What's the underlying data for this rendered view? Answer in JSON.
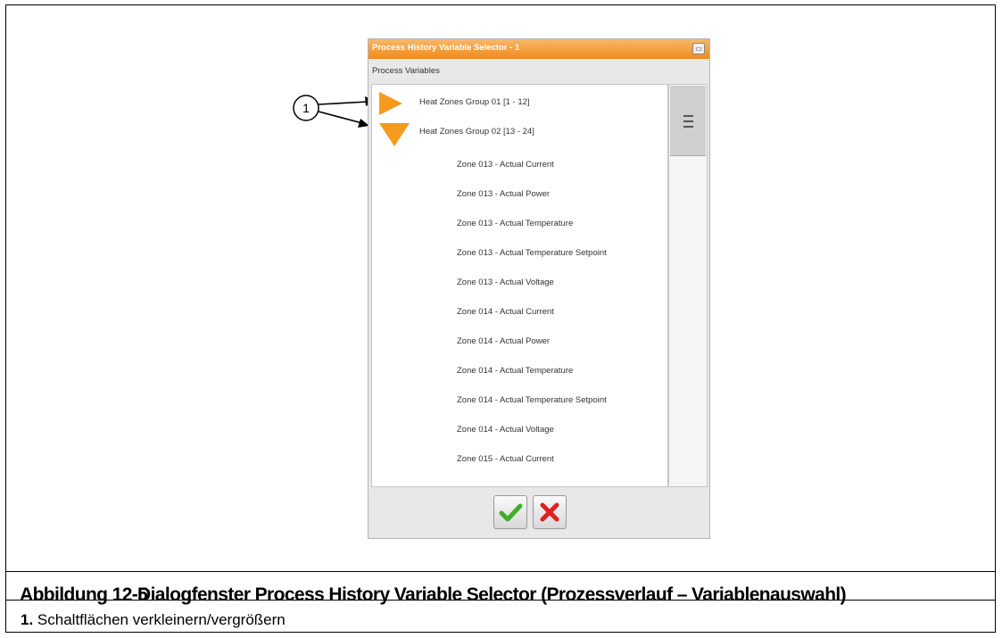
{
  "dialog": {
    "title": "Process History Variable Selector - 1",
    "section_label": "Process Variables",
    "groups": [
      {
        "label": "Heat Zones Group 01 [1 - 12]",
        "state": "collapsed"
      },
      {
        "label": "Heat Zones Group 02 [13 - 24]",
        "state": "expanded"
      }
    ],
    "items": [
      "Zone 013 - Actual Current",
      "Zone 013 - Actual Power",
      "Zone 013 - Actual Temperature",
      "Zone 013 - Actual Temperature Setpoint",
      "Zone 013 - Actual Voltage",
      "Zone 014 - Actual Current",
      "Zone 014 - Actual Power",
      "Zone 014 - Actual Temperature",
      "Zone 014 - Actual Temperature Setpoint",
      "Zone 014 - Actual Voltage",
      "Zone 015 - Actual Current"
    ],
    "ok_icon": "checkmark-icon",
    "cancel_icon": "x-icon",
    "accent_color": "#f59a1e"
  },
  "callout": {
    "number": "1"
  },
  "caption": {
    "figure_number": "Abbildung 12-5",
    "text": "Dialogfenster Process History Variable Selector (Prozessverlauf – Variablenauswahl)"
  },
  "legend": {
    "number": "1.",
    "text": "Schaltflächen verkleinern/vergrößern"
  }
}
